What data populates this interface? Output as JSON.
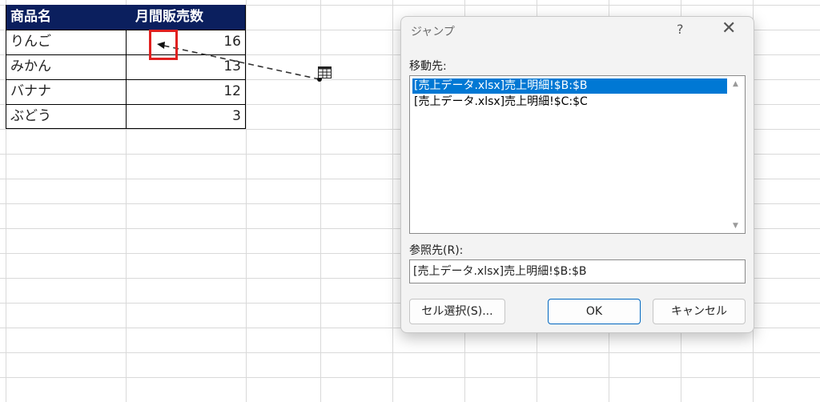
{
  "sheet": {
    "headers": [
      "商品名",
      "月間販売数"
    ],
    "rows": [
      {
        "name": "りんご",
        "qty": "16"
      },
      {
        "name": "みかん",
        "qty": "13"
      },
      {
        "name": "バナナ",
        "qty": "12"
      },
      {
        "name": "ぶどう",
        "qty": "3"
      }
    ],
    "colors": {
      "header_bg": "#0b1f5e",
      "header_text": "#ffffff",
      "highlight": "#e0201f"
    }
  },
  "dialog": {
    "title": "ジャンプ",
    "help": "?",
    "close": "✕",
    "goto_label": "移動先:",
    "goto_items": [
      "[売上データ.xlsx]売上明細!$B:$B",
      "[売上データ.xlsx]売上明細!$C:$C"
    ],
    "reference_label": "参照先(R):",
    "reference_value": "[売上データ.xlsx]売上明細!$B:$B",
    "special_button": "セル選択(S)...",
    "ok_button": "OK",
    "cancel_button": "キャンセル",
    "accent": "#0078d4"
  }
}
